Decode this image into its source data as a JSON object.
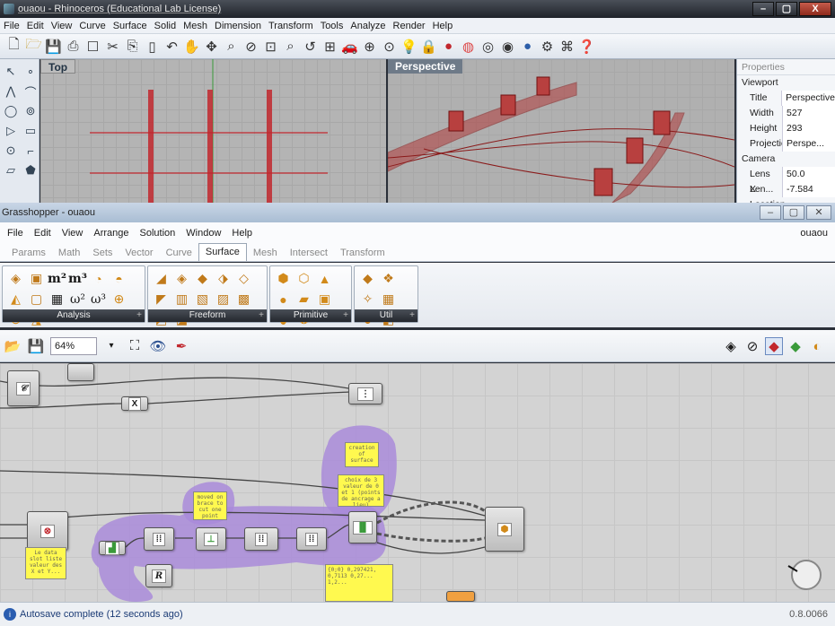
{
  "rhino": {
    "title": "ouaou - Rhinoceros (Educational Lab License)",
    "menu": [
      "File",
      "Edit",
      "View",
      "Curve",
      "Surface",
      "Solid",
      "Mesh",
      "Dimension",
      "Transform",
      "Tools",
      "Analyze",
      "Render",
      "Help"
    ],
    "viewports": {
      "top": "Top",
      "perspective": "Perspective"
    },
    "properties": {
      "header": "Properties",
      "section_viewport": "Viewport",
      "rows": [
        {
          "k": "Title",
          "v": "Perspective"
        },
        {
          "k": "Width",
          "v": "527"
        },
        {
          "k": "Height",
          "v": "293"
        },
        {
          "k": "Projection",
          "v": "Perspe..."
        }
      ],
      "section_camera": "Camera",
      "camera_rows": [
        {
          "k": "Lens Len...",
          "v": "50.0"
        },
        {
          "k": "X Location",
          "v": "-7.584"
        }
      ]
    }
  },
  "gh": {
    "title": "Grasshopper - ouaou",
    "menu": [
      "File",
      "Edit",
      "View",
      "Arrange",
      "Solution",
      "Window",
      "Help"
    ],
    "doc_name": "ouaou",
    "tabs": [
      "Params",
      "Math",
      "Sets",
      "Vector",
      "Curve",
      "Surface",
      "Mesh",
      "Intersect",
      "Transform"
    ],
    "active_tab": "Surface",
    "panels": [
      "Analysis",
      "Freeform",
      "Primitive",
      "Util"
    ],
    "zoom": "64%",
    "notes": {
      "n1": "creation of surface",
      "n2": "choix de 3 valeur de 0 et 1 (points de ancrage a lieu)",
      "n3": "moved on brace to cut one point",
      "n4": "Le data slot liste valeur des X et Y...",
      "n5": "{0;0} 0,297421, 0,7113 0,27... 1,2..."
    },
    "status": "Autosave complete (12 seconds ago)",
    "version": "0.8.0066"
  },
  "colors": {
    "accent_red": "#c1272d",
    "group_purple": "#a98bd9",
    "note_yellow": "#fff94f"
  }
}
